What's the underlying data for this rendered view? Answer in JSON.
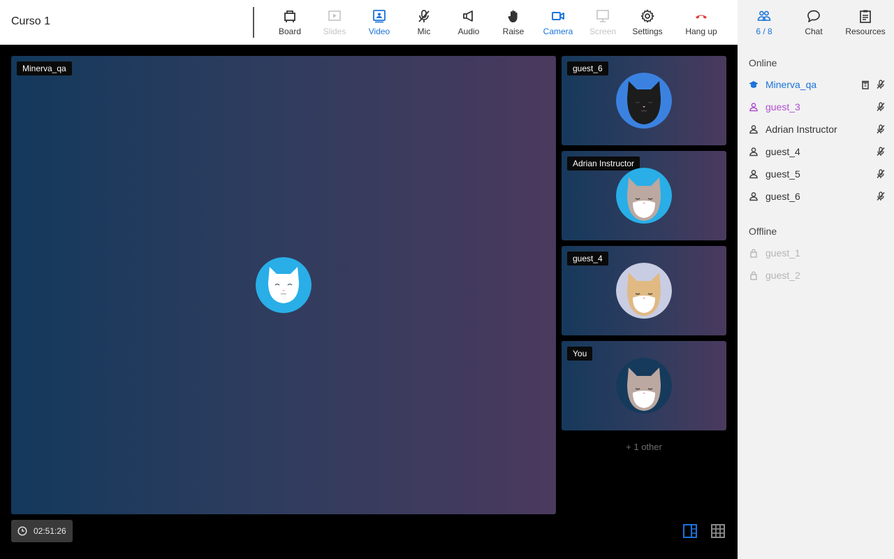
{
  "course_title": "Curso 1",
  "toolbar": [
    {
      "name": "board",
      "label": "Board",
      "state": "normal"
    },
    {
      "name": "slides",
      "label": "Slides",
      "state": "disabled"
    },
    {
      "name": "video",
      "label": "Video",
      "state": "active"
    },
    {
      "name": "mic",
      "label": "Mic",
      "state": "normal"
    },
    {
      "name": "audio",
      "label": "Audio",
      "state": "normal"
    },
    {
      "name": "raise",
      "label": "Raise",
      "state": "normal"
    },
    {
      "name": "camera",
      "label": "Camera",
      "state": "active"
    },
    {
      "name": "screen",
      "label": "Screen",
      "state": "disabled"
    },
    {
      "name": "settings",
      "label": "Settings",
      "state": "normal"
    },
    {
      "name": "hangup",
      "label": "Hang up",
      "state": "normal"
    }
  ],
  "side_tabs": {
    "people": "6 / 8",
    "chat": "Chat",
    "resources": "Resources"
  },
  "participants": {
    "online_title": "Online",
    "offline_title": "Offline",
    "online": [
      {
        "name": "Minerva_qa",
        "role": "instructor",
        "actions": [
          "trash-icon",
          "mic-off-icon"
        ]
      },
      {
        "name": "guest_3",
        "role": "highlighted",
        "actions": [
          "mic-off-icon"
        ]
      },
      {
        "name": "Adrian Instructor",
        "role": "guest",
        "actions": [
          "mic-off-icon"
        ]
      },
      {
        "name": "guest_4",
        "role": "guest",
        "actions": [
          "mic-off-icon"
        ]
      },
      {
        "name": "guest_5",
        "role": "guest",
        "actions": [
          "mic-off-icon"
        ]
      },
      {
        "name": "guest_6",
        "role": "guest",
        "actions": [
          "mic-off-icon"
        ]
      }
    ],
    "offline": [
      {
        "name": "guest_1"
      },
      {
        "name": "guest_2"
      }
    ]
  },
  "main_video": {
    "name": "Minerva_qa"
  },
  "tiles": [
    {
      "name": "guest_6"
    },
    {
      "name": "Adrian Instructor"
    },
    {
      "name": "guest_4"
    },
    {
      "name": "You"
    }
  ],
  "more_others": "+ 1 other",
  "timer": "02:51:26",
  "colors": {
    "accent": "#1a73d9",
    "hangup": "#e53935",
    "guest_highlight": "#b14fcf",
    "offline": "#b5b5b5"
  }
}
